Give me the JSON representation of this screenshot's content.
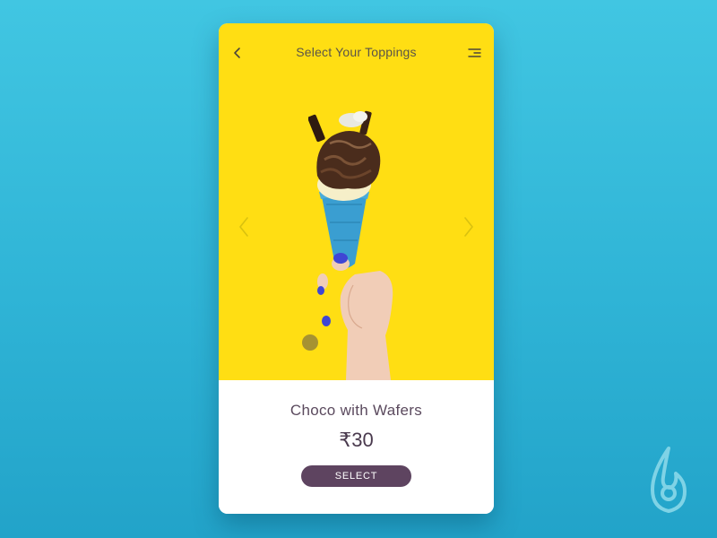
{
  "header": {
    "title": "Select Your Toppings",
    "back_icon": "chevron-left-icon",
    "menu_icon": "menu-icon"
  },
  "carousel": {
    "prev_icon": "chevron-left-icon",
    "next_icon": "chevron-right-icon",
    "background_color": "#ffde13"
  },
  "product": {
    "name": "Choco with Wafers",
    "currency": "₹",
    "price": "30"
  },
  "actions": {
    "select_label": "SELECT",
    "button_color": "#5e4460"
  },
  "colors": {
    "background": "#2fb4d6",
    "accent": "#ffde13"
  }
}
